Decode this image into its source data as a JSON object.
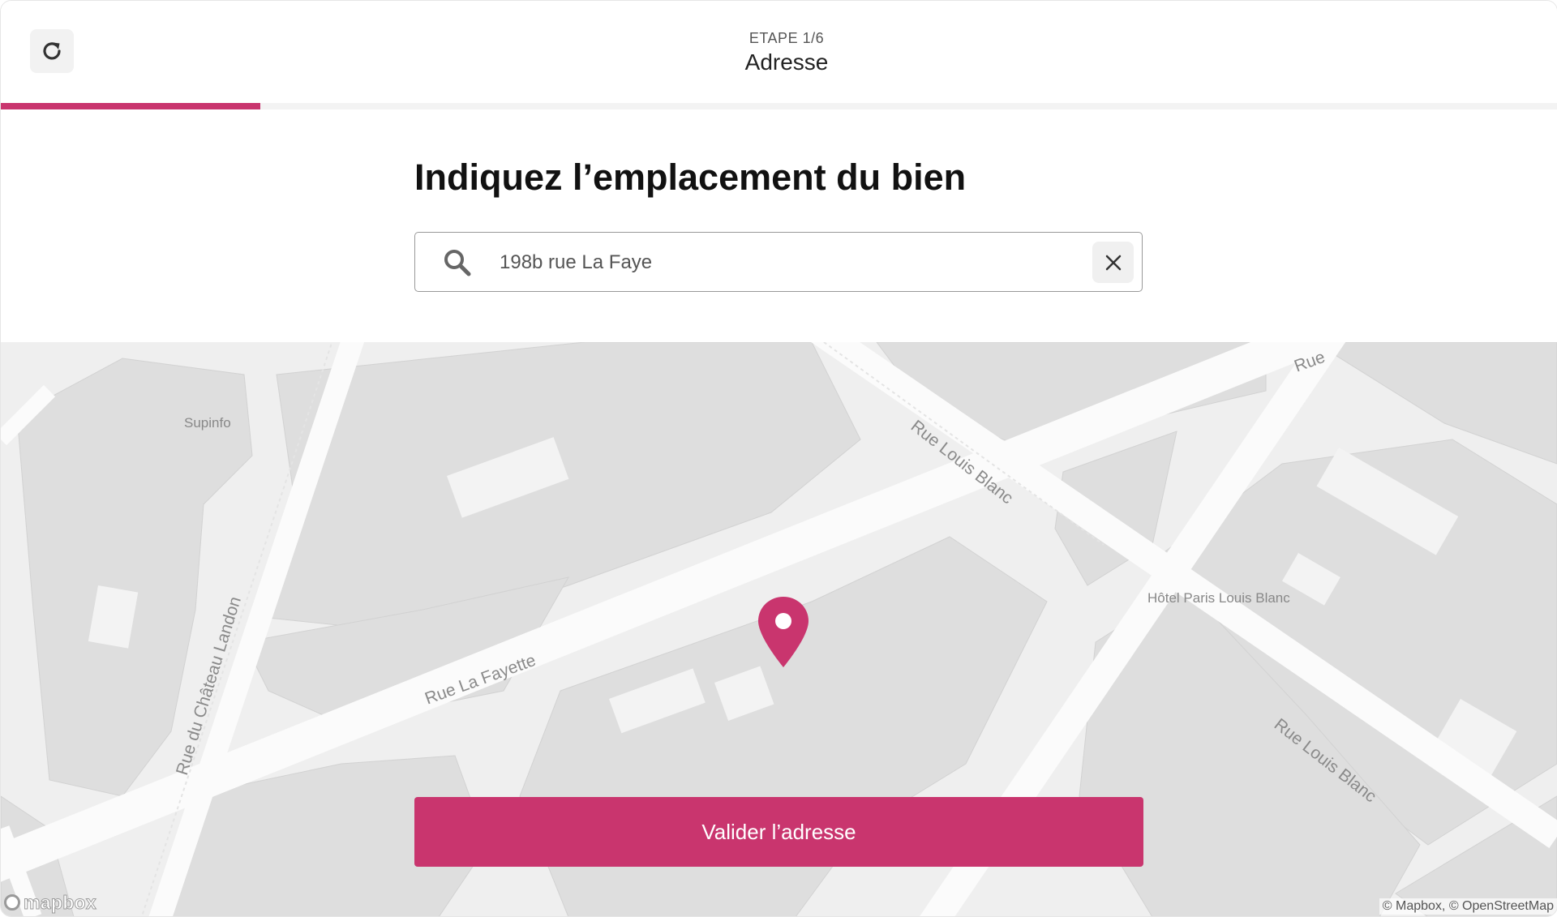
{
  "header": {
    "refresh_icon": "refresh-icon",
    "step_label": "ETAPE 1/6",
    "step_title": "Adresse",
    "progress_fraction": 0.167,
    "accent_color": "#c9356e"
  },
  "question": {
    "title": "Indiquez l’emplacement du bien",
    "search": {
      "icon": "search-icon",
      "value": "198b rue La Faye",
      "clear_icon": "close-icon"
    }
  },
  "map": {
    "streets": [
      "Rue La Fayette",
      "Rue Louis Blanc",
      "Rue Louis Blanc",
      "Rue du Château Landon",
      "Rue"
    ],
    "pois": [
      "Supinfo",
      "Hôtel Paris Louis Blanc"
    ],
    "marker_icon": "map-pin-icon",
    "logo_text": "mapbox",
    "attribution": "© Mapbox, © OpenStreetMap"
  },
  "actions": {
    "validate_label": "Valider l’adresse"
  }
}
